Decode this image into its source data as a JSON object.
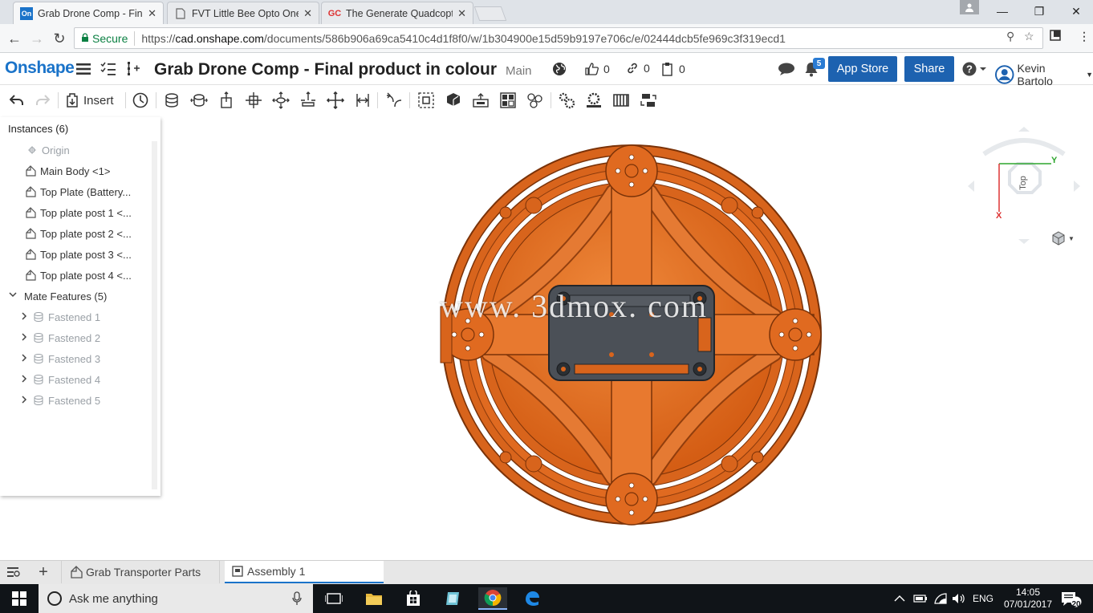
{
  "browser": {
    "tabs": [
      {
        "favicon": "On",
        "title": "Grab Drone Comp - Fina",
        "active": true
      },
      {
        "favicon": "doc",
        "title": "FVT Little Bee Opto One",
        "active": false
      },
      {
        "favicon": "GC",
        "title": "The Generate Quadcopte",
        "active": false
      }
    ],
    "secure_label": "Secure",
    "url_prefix": "https://",
    "url_host": "cad.onshape.com",
    "url_path": "/documents/586b906a69ca5410c4d1f8f0/w/1b304900e15d59b9197e706c/e/02444dcb5fe969c3f319ecd1"
  },
  "header": {
    "logo": "Onshape",
    "doc_title": "Grab Drone Comp - Final product in colour",
    "branch": "Main",
    "likes": "0",
    "links": "0",
    "copies": "0",
    "notifications": "5",
    "app_store_label": "App Store",
    "share_label": "Share",
    "user_name": "Kevin Bartolo"
  },
  "toolbar": {
    "insert_label": "Insert"
  },
  "panel": {
    "instances_header": "Instances (6)",
    "origin": "Origin",
    "instances": [
      "Main Body <1>",
      "Top Plate (Battery...",
      "Top plate post 1 <...",
      "Top plate post 2 <...",
      "Top plate post 3 <...",
      "Top plate post 4 <..."
    ],
    "mate_header": "Mate Features (5)",
    "mates": [
      "Fastened 1",
      "Fastened 2",
      "Fastened 3",
      "Fastened 4",
      "Fastened 5"
    ]
  },
  "viewcube": {
    "face_label": "Top",
    "axis_y": "Y",
    "axis_x": "X"
  },
  "watermark": "www. 3dmox. com",
  "bottom_tabs": [
    {
      "label": "Grab Transporter Parts",
      "active": false
    },
    {
      "label": "Assembly 1",
      "active": true
    }
  ],
  "taskbar": {
    "search_placeholder": "Ask me anything",
    "language": "ENG",
    "time": "14:05",
    "date": "07/01/2017",
    "notification_count": "20"
  },
  "colors": {
    "onshape_blue": "#1a73c9",
    "button_blue": "#1d62b0",
    "drone_orange": "#e2691e",
    "plate_gray": "#4b5057"
  }
}
